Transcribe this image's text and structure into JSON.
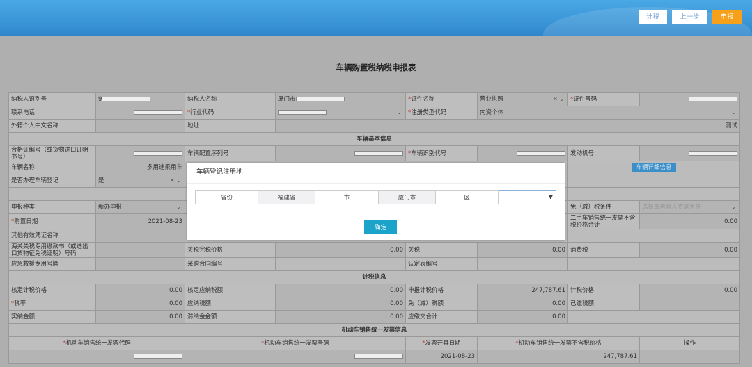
{
  "header": {
    "calc_label": "计税",
    "prev_label": "上一步",
    "submit_label": "申报",
    "colors": {
      "bar": "#3b95d6",
      "submit": "#f7a11a",
      "confirm": "#1ca3c9"
    }
  },
  "page_title": "车辆购置税纳税申报表",
  "form_rows": [
    {
      "cells": [
        {
          "t": "纳税人识别号",
          "c": "l"
        },
        {
          "t": "9",
          "c": "v",
          "m": 1
        },
        {
          "t": "纳税人名称",
          "c": "l"
        },
        {
          "t": "厦门市",
          "c": "v",
          "m": 1
        },
        {
          "t": "证件名称",
          "c": "l",
          "r": 1
        },
        {
          "t": "营业执照",
          "c": "v",
          "sel": 1,
          "x": 1
        },
        {
          "t": "证件号码",
          "c": "l",
          "r": 1
        },
        {
          "t": "",
          "c": "v",
          "m": 1,
          "a": "r"
        }
      ]
    },
    {
      "cells": [
        {
          "t": "联系电话",
          "c": "l"
        },
        {
          "t": "",
          "c": "v",
          "m": 1,
          "a": "r"
        },
        {
          "t": "行业代码",
          "c": "l",
          "r": 1
        },
        {
          "t": "",
          "c": "v",
          "m": 1,
          "sel": 1
        },
        {
          "t": "注册类型代码",
          "c": "l",
          "r": 1
        },
        {
          "t": "内资个体",
          "c": "v",
          "sel": 1,
          "sp": 3
        }
      ]
    },
    {
      "cells": [
        {
          "t": "外籍个人中文名称",
          "c": "l"
        },
        {
          "t": "",
          "c": "v"
        },
        {
          "t": "地址",
          "c": "l"
        },
        {
          "t": "测试",
          "c": "v",
          "sp": 5,
          "a": "r"
        }
      ]
    },
    {
      "cells": [
        {
          "t": "车辆基本信息",
          "c": "s",
          "sp": 8
        }
      ]
    },
    {
      "tall": 1,
      "cells": [
        {
          "t": "合格证编号（或货物进口证明书号）",
          "c": "l"
        },
        {
          "t": "",
          "c": "v",
          "m": 1,
          "a": "r"
        },
        {
          "t": "车辆配置序列号",
          "c": "l"
        },
        {
          "t": "",
          "c": "v",
          "m": 1,
          "a": "r"
        },
        {
          "t": "车辆识别代号",
          "c": "l",
          "r": 1
        },
        {
          "t": "",
          "c": "v",
          "m": 1,
          "a": "r"
        },
        {
          "t": "发动机号",
          "c": "l"
        },
        {
          "t": "",
          "c": "v",
          "m": 1,
          "a": "r"
        }
      ]
    },
    {
      "cells": [
        {
          "t": "车辆名称",
          "c": "l"
        },
        {
          "t": "多用途乘用车",
          "c": "v",
          "a": "r"
        },
        {
          "t": "",
          "c": "e",
          "sp": 4
        },
        {
          "t": "车辆详细信息",
          "c": "e",
          "sp": 2,
          "btn": 1
        }
      ]
    },
    {
      "cells": [
        {
          "t": "是否办理车辆登记",
          "c": "l"
        },
        {
          "t": "是",
          "c": "v",
          "sel": 1,
          "x": 1
        },
        {
          "t": "",
          "c": "e",
          "sp": 4
        },
        {
          "t": "",
          "c": "e",
          "sp": 2
        }
      ]
    },
    {
      "cells": [
        {
          "t": "",
          "c": "e",
          "sp": 2
        },
        {
          "t": "",
          "c": "e",
          "sp": 4
        },
        {
          "t": "",
          "c": "e",
          "sp": 2
        }
      ]
    },
    {
      "cells": [
        {
          "t": "申报种类",
          "c": "l"
        },
        {
          "t": "新办申报",
          "c": "v",
          "sel": 1
        },
        {
          "t": "",
          "c": "e",
          "sp": 4
        },
        {
          "t": "免（减）税条件",
          "c": "l"
        },
        {
          "t": "选择或者输入查询条件",
          "c": "v",
          "sel": 1,
          "ph": 1
        }
      ]
    },
    {
      "tall": 1,
      "cells": [
        {
          "t": "购置日期",
          "c": "l",
          "r": 1
        },
        {
          "t": "2021-08-23",
          "c": "v",
          "a": "r"
        },
        {
          "t": "",
          "c": "e",
          "sp": 4
        },
        {
          "t": "二手车销售统一发票不含税价格合计",
          "c": "l"
        },
        {
          "t": "0.00",
          "c": "v",
          "a": "r"
        }
      ]
    },
    {
      "cells": [
        {
          "t": "其他有效凭证名称",
          "c": "l"
        },
        {
          "t": "",
          "c": "v"
        },
        {
          "t": "",
          "c": "e",
          "sp": 4
        },
        {
          "t": "",
          "c": "e",
          "sp": 2
        }
      ]
    },
    {
      "tall": 1,
      "cells": [
        {
          "t": "海关关税专用缴款书（或进出口货物征免税证明）号码",
          "c": "l"
        },
        {
          "t": "",
          "c": "v"
        },
        {
          "t": "关税完税价格",
          "c": "l"
        },
        {
          "t": "0.00",
          "c": "v",
          "a": "r"
        },
        {
          "t": "关税",
          "c": "l"
        },
        {
          "t": "0.00",
          "c": "v",
          "a": "r"
        },
        {
          "t": "消费税",
          "c": "l"
        },
        {
          "t": "0.00",
          "c": "v",
          "a": "r"
        }
      ]
    },
    {
      "cells": [
        {
          "t": "应急救援专用号牌",
          "c": "l"
        },
        {
          "t": "",
          "c": "v"
        },
        {
          "t": "采购合同编号",
          "c": "l"
        },
        {
          "t": "",
          "c": "e"
        },
        {
          "t": "认定表编号",
          "c": "l"
        },
        {
          "t": "",
          "c": "e"
        },
        {
          "t": "",
          "c": "e",
          "sp": 2
        }
      ]
    },
    {
      "cells": [
        {
          "t": "计税信息",
          "c": "s",
          "sp": 8
        }
      ]
    },
    {
      "cells": [
        {
          "t": "核定计税价格",
          "c": "l"
        },
        {
          "t": "0.00",
          "c": "v",
          "a": "r"
        },
        {
          "t": "核定应纳税额",
          "c": "l"
        },
        {
          "t": "0.00",
          "c": "v",
          "a": "r"
        },
        {
          "t": "申报计税价格",
          "c": "l"
        },
        {
          "t": "247,787.61",
          "c": "v",
          "a": "r"
        },
        {
          "t": "计税价格",
          "c": "l"
        },
        {
          "t": "0.00",
          "c": "v",
          "a": "r"
        }
      ]
    },
    {
      "cells": [
        {
          "t": "税率",
          "c": "l",
          "r": 1
        },
        {
          "t": "0.00",
          "c": "v",
          "a": "r"
        },
        {
          "t": "应纳税额",
          "c": "l"
        },
        {
          "t": "0.00",
          "c": "v",
          "a": "r"
        },
        {
          "t": "免（减）税额",
          "c": "l"
        },
        {
          "t": "0.00",
          "c": "v",
          "a": "r"
        },
        {
          "t": "已缴税额",
          "c": "l"
        },
        {
          "t": "",
          "c": "v"
        }
      ]
    },
    {
      "cells": [
        {
          "t": "实纳金额",
          "c": "l"
        },
        {
          "t": "0.00",
          "c": "v",
          "a": "r"
        },
        {
          "t": "滞纳金金额",
          "c": "l"
        },
        {
          "t": "0.00",
          "c": "v",
          "a": "r"
        },
        {
          "t": "应缴交合计",
          "c": "l"
        },
        {
          "t": "0.00",
          "c": "v",
          "a": "r"
        },
        {
          "t": "",
          "c": "e",
          "sp": 2
        }
      ]
    },
    {
      "cells": [
        {
          "t": "机动车销售统一发票信息",
          "c": "s",
          "sp": 8
        }
      ]
    },
    {
      "cells": [
        {
          "t": "机动车销售统一发票代码",
          "c": "h",
          "r": 1,
          "sp": 2
        },
        {
          "t": "机动车销售统一发票号码",
          "c": "h",
          "r": 1,
          "sp": 2
        },
        {
          "t": "发票开具日期",
          "c": "h",
          "r": 1
        },
        {
          "t": "机动车销售统一发票不含税价格",
          "c": "h",
          "r": 1,
          "sp": 2
        },
        {
          "t": "操作",
          "c": "h"
        }
      ]
    },
    {
      "cells": [
        {
          "t": "",
          "c": "v",
          "m": 1,
          "a": "r",
          "sp": 2
        },
        {
          "t": "",
          "c": "v",
          "m": 1,
          "a": "r",
          "sp": 2
        },
        {
          "t": "2021-08-23",
          "c": "v",
          "a": "r"
        },
        {
          "t": "247,787.61",
          "c": "v",
          "a": "r",
          "sp": 2
        },
        {
          "t": "",
          "c": "v"
        }
      ]
    }
  ],
  "modal": {
    "title": "车辆登记注册地",
    "province_label": "省份",
    "province_value": "福建省",
    "city_label": "市",
    "city_value": "厦门市",
    "district_label": "区",
    "district_value": "",
    "confirm_label": "确定"
  }
}
